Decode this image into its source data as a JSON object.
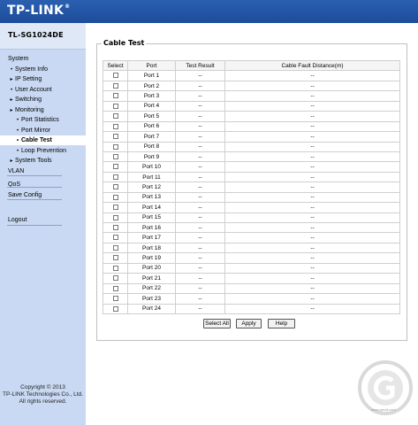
{
  "brand": {
    "logo": "TP-LINK",
    "reg_mark": "®"
  },
  "sidebar": {
    "model": "TL-SG1024DE",
    "items": [
      {
        "label": "System",
        "bullet": ""
      },
      {
        "label": "System Info",
        "bullet": "•"
      },
      {
        "label": "IP Setting",
        "bullet": "▸"
      },
      {
        "label": "User Account",
        "bullet": "•"
      },
      {
        "label": "Switching",
        "bullet": "▸"
      },
      {
        "label": "Monitoring",
        "bullet": "▸"
      },
      {
        "label": "Port Statistics",
        "bullet": "•"
      },
      {
        "label": "Port Mirror",
        "bullet": "•"
      },
      {
        "label": "Cable Test",
        "bullet": "•"
      },
      {
        "label": "Loop Prevention",
        "bullet": "•"
      },
      {
        "label": "System Tools",
        "bullet": "▸"
      },
      {
        "label": "VLAN",
        "bullet": ""
      },
      {
        "label": "QoS",
        "bullet": ""
      },
      {
        "label": "Save Config",
        "bullet": ""
      },
      {
        "label": "Logout",
        "bullet": ""
      }
    ],
    "copyright": [
      "Copyright © 2013",
      "TP-LINK Technologies Co., Ltd.",
      "All rights reserved."
    ]
  },
  "main": {
    "title": "Cable Test",
    "columns": [
      "Select",
      "Port",
      "Test Result",
      "Cable Fault Distance(m)"
    ],
    "rows": [
      {
        "port": "Port 1",
        "result": "--",
        "distance": "--"
      },
      {
        "port": "Port 2",
        "result": "--",
        "distance": "--"
      },
      {
        "port": "Port 3",
        "result": "--",
        "distance": "--"
      },
      {
        "port": "Port 4",
        "result": "--",
        "distance": "--"
      },
      {
        "port": "Port 5",
        "result": "--",
        "distance": "--"
      },
      {
        "port": "Port 6",
        "result": "--",
        "distance": "--"
      },
      {
        "port": "Port 7",
        "result": "--",
        "distance": "--"
      },
      {
        "port": "Port 8",
        "result": "--",
        "distance": "--"
      },
      {
        "port": "Port 9",
        "result": "--",
        "distance": "--"
      },
      {
        "port": "Port 10",
        "result": "--",
        "distance": "--"
      },
      {
        "port": "Port 11",
        "result": "--",
        "distance": "--"
      },
      {
        "port": "Port 12",
        "result": "--",
        "distance": "--"
      },
      {
        "port": "Port 13",
        "result": "--",
        "distance": "--"
      },
      {
        "port": "Port 14",
        "result": "--",
        "distance": "--"
      },
      {
        "port": "Port 15",
        "result": "--",
        "distance": "--"
      },
      {
        "port": "Port 16",
        "result": "--",
        "distance": "--"
      },
      {
        "port": "Port 17",
        "result": "--",
        "distance": "--"
      },
      {
        "port": "Port 18",
        "result": "--",
        "distance": "--"
      },
      {
        "port": "Port 19",
        "result": "--",
        "distance": "--"
      },
      {
        "port": "Port 20",
        "result": "--",
        "distance": "--"
      },
      {
        "port": "Port 21",
        "result": "--",
        "distance": "--"
      },
      {
        "port": "Port 22",
        "result": "--",
        "distance": "--"
      },
      {
        "port": "Port 23",
        "result": "--",
        "distance": "--"
      },
      {
        "port": "Port 24",
        "result": "--",
        "distance": "--"
      }
    ],
    "buttons": {
      "select_all": "Select All",
      "apply": "Apply",
      "help": "Help"
    }
  },
  "watermark": {
    "url": "www.gecid.com"
  },
  "colors": {
    "header": "#1d4c9a",
    "sidebar": "#c9d9f3",
    "border": "#c0c0c0"
  }
}
